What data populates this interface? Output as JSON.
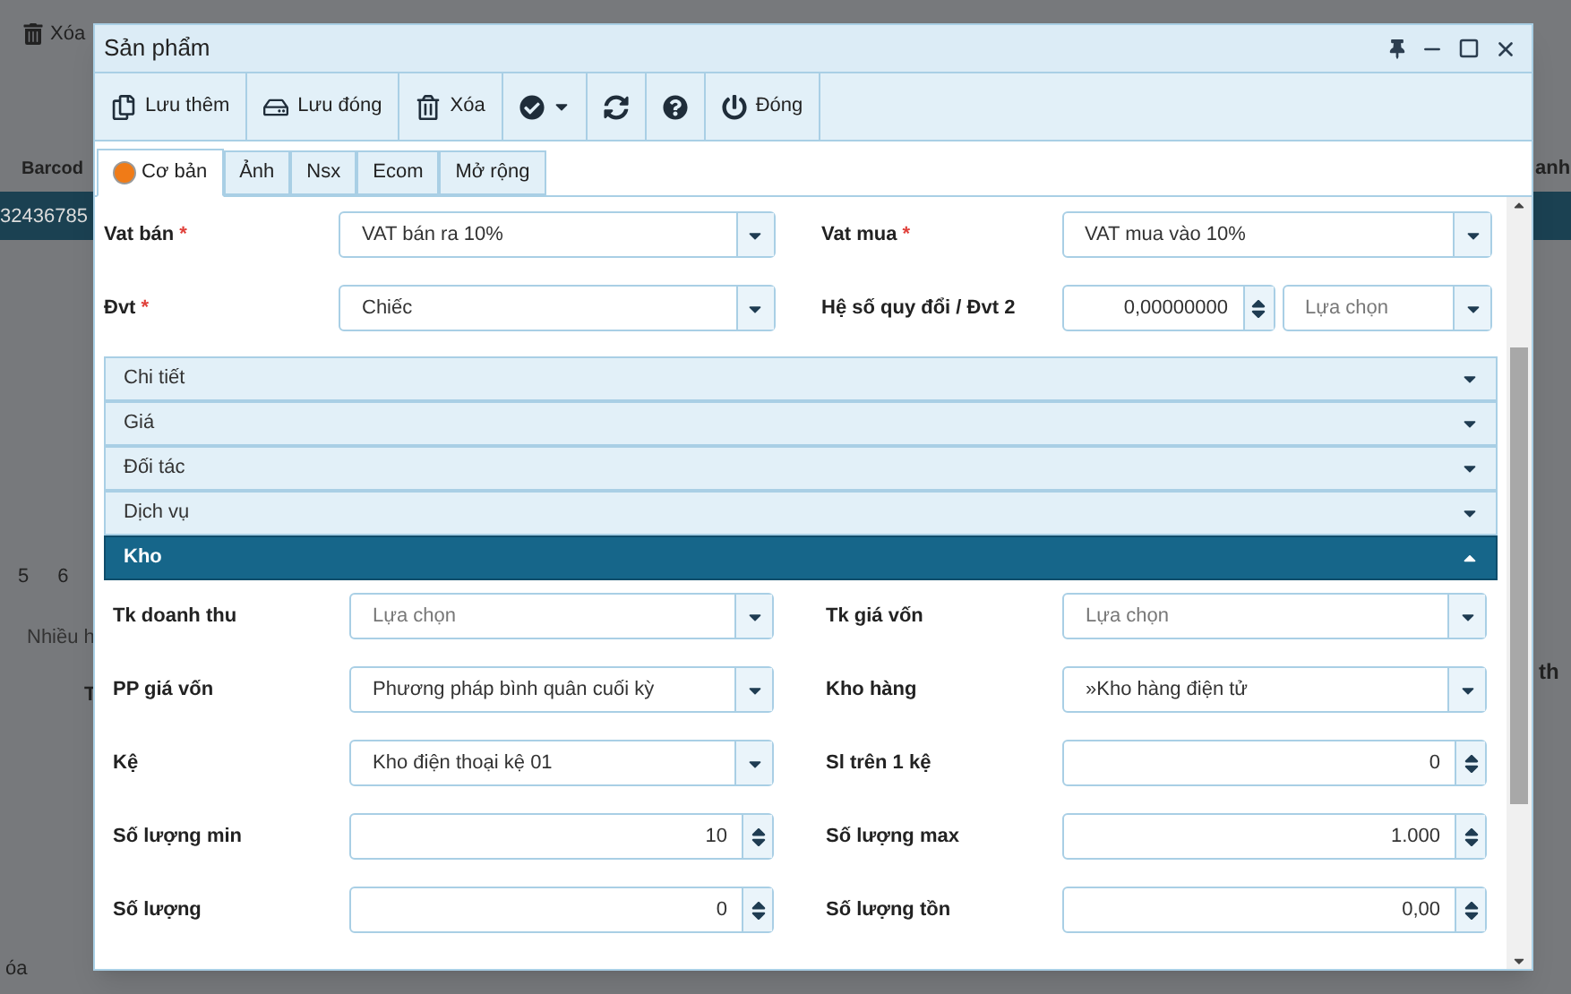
{
  "background": {
    "toolbar_button": "Xóa",
    "column_1": "Barcod",
    "column_2": "anh",
    "row_cell": "32436785",
    "pages": [
      "5",
      "6"
    ],
    "text_1": "Nhiều h",
    "text_2": "T",
    "text_3": "th",
    "tab": "óa"
  },
  "window": {
    "title": "Sản phẩm"
  },
  "toolbar": [
    {
      "label": "Lưu thêm"
    },
    {
      "label": "Lưu đóng"
    },
    {
      "label": "Xóa"
    },
    {
      "has_menu": true
    },
    {
      "has_menu": false
    },
    {
      "has_menu": false
    },
    {
      "label": "Đóng"
    }
  ],
  "tabs": [
    {
      "label": "Cơ bản",
      "selected": true
    },
    {
      "label": "Ảnh",
      "selected": false
    },
    {
      "label": "Nsx",
      "selected": false
    },
    {
      "label": "Ecom",
      "selected": false
    },
    {
      "label": "Mở rộng",
      "selected": false
    }
  ],
  "fields": [
    {
      "label": "Vat bán",
      "required_mark": "*",
      "kind": "select",
      "value": "VAT bán ra 10%"
    },
    {
      "label": "Vat mua",
      "required_mark": "*",
      "kind": "select",
      "value": "VAT mua vào 10%"
    },
    {
      "label": "Đvt",
      "required_mark": "*",
      "kind": "select",
      "value": "Chiếc"
    },
    {
      "label": "Hệ số quy đổi / Đvt 2",
      "kind": "number_select",
      "value": "0,00000000",
      "placeholder": "Lựa chọn"
    }
  ],
  "sections": [
    {
      "title": "Chi tiết",
      "expanded": false
    },
    {
      "title": "Giá",
      "expanded": false
    },
    {
      "title": "Đối tác",
      "expanded": false
    },
    {
      "title": "Dịch vụ",
      "expanded": false
    },
    {
      "title": "Kho",
      "expanded": true,
      "fields": [
        {
          "label": "Tk doanh thu",
          "kind": "select",
          "placeholder": "Lựa chọn"
        },
        {
          "label": "Tk giá vốn",
          "kind": "select",
          "placeholder": "Lựa chọn"
        },
        {
          "label": "PP giá vốn",
          "kind": "select",
          "value": "Phương pháp bình quân cuối kỳ"
        },
        {
          "label": "Kho hàng",
          "kind": "select",
          "value": "»Kho hàng điện tử"
        },
        {
          "label": "Kệ",
          "kind": "select",
          "value": "Kho điện thoại kệ 01"
        },
        {
          "label": "Sl trên 1 kệ",
          "kind": "number",
          "value": "0"
        },
        {
          "label": "Số lượng min",
          "kind": "number",
          "value": "10"
        },
        {
          "label": "Số lượng max",
          "kind": "number",
          "value": "1.000"
        },
        {
          "label": "Số lượng",
          "kind": "number",
          "value": "0"
        },
        {
          "label": "Số lượng tồn",
          "kind": "number",
          "value": "0,00"
        }
      ]
    }
  ]
}
